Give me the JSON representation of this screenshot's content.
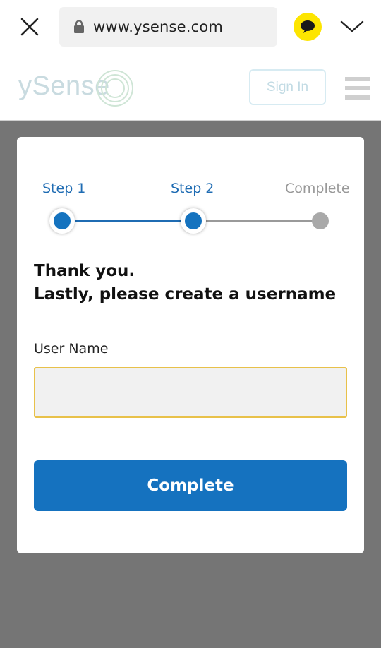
{
  "browser": {
    "url": "www.ysense.com",
    "accent_color": "#fde500"
  },
  "header": {
    "logo_text": "ySense",
    "sign_in_label": "Sign In"
  },
  "steps": [
    {
      "label": "Step 1",
      "state": "done"
    },
    {
      "label": "Step 2",
      "state": "current"
    },
    {
      "label": "Complete",
      "state": "pending"
    }
  ],
  "form": {
    "heading_line1": "Thank you.",
    "heading_line2": "Lastly, please create a username",
    "username_label": "User Name",
    "username_value": "",
    "submit_label": "Complete"
  },
  "colors": {
    "primary": "#1572bf",
    "input_border": "#e8c14a",
    "backdrop": "#757575"
  }
}
